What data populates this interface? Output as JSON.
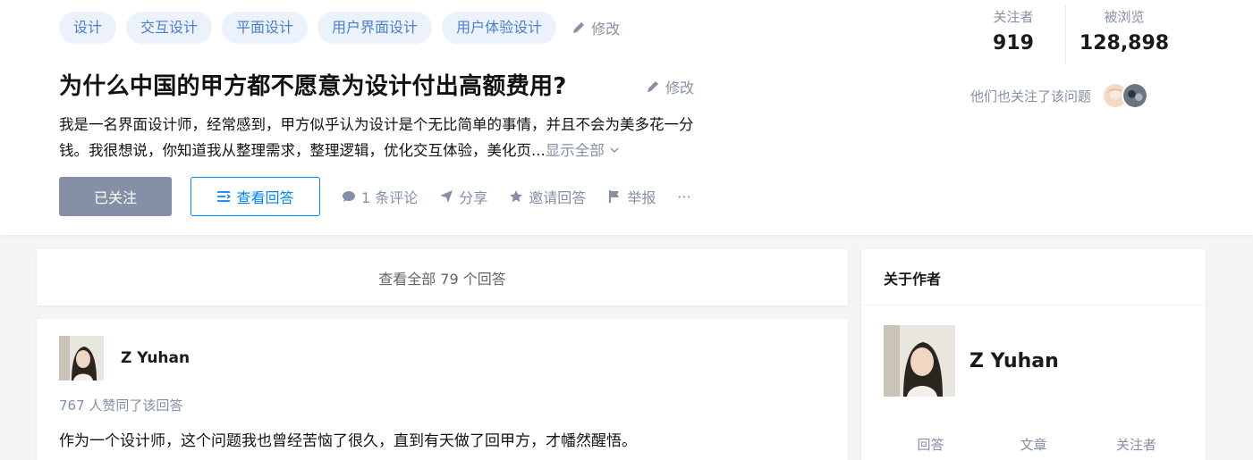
{
  "question": {
    "topics": [
      "设计",
      "交互设计",
      "平面设计",
      "用户界面设计",
      "用户体验设计"
    ],
    "edit_label": "修改",
    "title": "为什么中国的甲方都不愿意为设计付出高额费用?",
    "title_edit_label": "修改",
    "detail_line1": "我是一名界面设计师，经常感到，甲方似乎认为设计是个无比简单的事情，并且不会为美多花一分",
    "detail_line2": "钱。我很想说，你知道我从整理需求，整理逻辑，优化交互体验，美化页...",
    "show_all": "显示全部",
    "actions": {
      "followed": "已关注",
      "view_answers": "查看回答",
      "comments": "1 条评论",
      "share": "分享",
      "invite": "邀请回答",
      "report": "举报",
      "more": "···"
    },
    "stats": {
      "followers_label": "关注者",
      "followers_value": "919",
      "views_label": "被浏览",
      "views_value": "128,898"
    },
    "also_followed": "他们也关注了该问题"
  },
  "main": {
    "view_all": "查看全部 79 个回答",
    "answer": {
      "author": "Z Yuhan",
      "votes": "767 人赞同了该回答",
      "excerpt": "作为一个设计师，这个问题我也曾经苦恼了很久，直到有天做了回甲方，才幡然醒悟。"
    }
  },
  "sidebar": {
    "title": "关于作者",
    "author": "Z Yuhan",
    "stats": [
      "回答",
      "文章",
      "关注者"
    ]
  },
  "colors": {
    "accent": "#0084ff",
    "tag_bg": "#ebf2fc",
    "tag_text": "#4a7fd0",
    "muted": "#8590a6",
    "page_bg": "#f4f5f7"
  }
}
